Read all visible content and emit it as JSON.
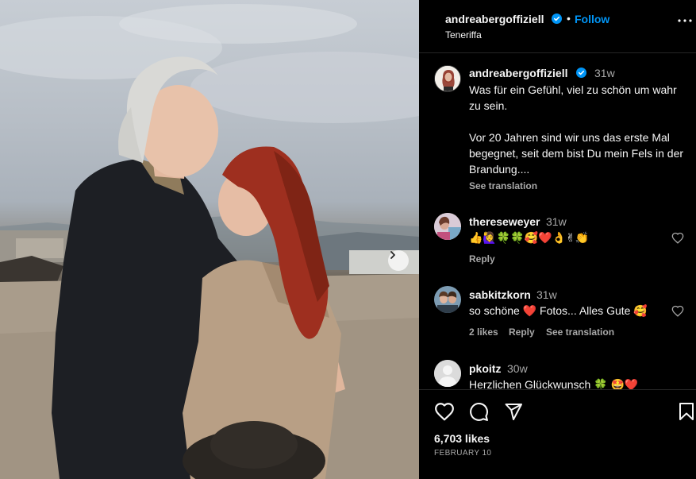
{
  "post": {
    "author": "andreabergoffiziell",
    "follow_label": "Follow",
    "separator": "•",
    "location": "Teneriffa"
  },
  "caption": {
    "username": "andreabergoffiziell",
    "time": "31w",
    "line1": "Was für ein Gefühl, viel zu schön um wahr zu sein.",
    "line2": "Vor 20 Jahren sind wir uns das erste Mal begegnet, seit dem bist Du mein Fels in der Brandung....",
    "see_translation": "See translation"
  },
  "comments": [
    {
      "username": "thereseweyer",
      "time": "31w",
      "text": "👍🙋‍♀️🍀🍀🥰❤️👌✌👏",
      "reply": "Reply"
    },
    {
      "username": "sabkitzkorn",
      "time": "31w",
      "text": "so schöne ❤️ Fotos... Alles Gute 🥰",
      "likes": "2 likes",
      "reply": "Reply",
      "see_translation": "See translation"
    },
    {
      "username": "pkoitz",
      "time": "30w",
      "text": "Herzlichen Glückwunsch 🍀 🤩❤️"
    }
  ],
  "footer": {
    "likes": "6,703 likes",
    "date": "FEBRUARY 10"
  },
  "icons": {
    "verified": "verified-badge-icon",
    "more": "more-options-icon",
    "like": "heart-icon",
    "comment": "comment-icon",
    "share": "send-icon",
    "save": "bookmark-icon",
    "next": "chevron-right-icon"
  },
  "colors": {
    "accent": "#0095f6",
    "muted": "#a8a8a8",
    "background": "#000000"
  }
}
